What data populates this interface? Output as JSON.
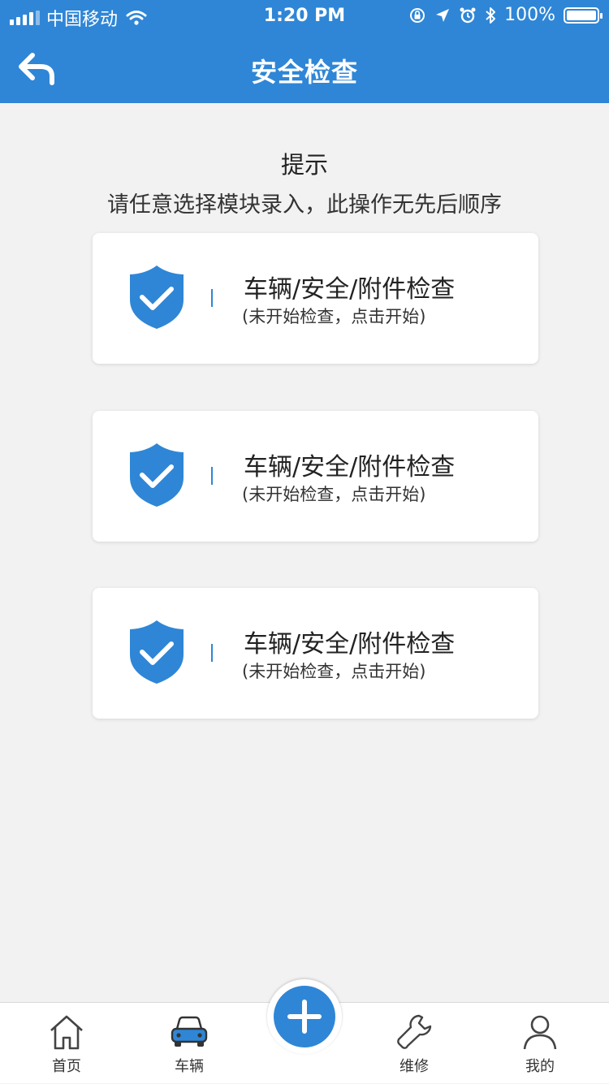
{
  "status_bar": {
    "carrier": "中国移动",
    "time": "1:20 PM",
    "battery": "100%",
    "battery_level": 1.0,
    "icons": [
      "signal-icon",
      "wifi-icon",
      "orientation-lock-icon",
      "location-icon",
      "alarm-icon",
      "bluetooth-icon",
      "battery-icon"
    ]
  },
  "nav": {
    "title": "安全检查",
    "back_icon": "back-arrow-icon"
  },
  "hint": {
    "title": "提示",
    "text": "请任意选择模块录入，此操作无先后顺序"
  },
  "modules": [
    {
      "title": "车辆/安全/附件检查",
      "status": "(未开始检查，点击开始)",
      "icon": "shield-check-icon"
    },
    {
      "title": "车辆/安全/附件检查",
      "status": "(未开始检查，点击开始)",
      "icon": "shield-check-icon"
    },
    {
      "title": "车辆/安全/附件检查",
      "status": "(未开始检查，点击开始)",
      "icon": "shield-check-icon"
    }
  ],
  "tabbar": {
    "tabs": [
      {
        "label": "首页",
        "icon": "home-icon",
        "active": false
      },
      {
        "label": "车辆",
        "icon": "car-icon",
        "active": true
      },
      {
        "label": "维修",
        "icon": "wrench-icon",
        "active": false
      },
      {
        "label": "我的",
        "icon": "user-icon",
        "active": false
      }
    ],
    "center_icon": "plus-icon"
  },
  "colors": {
    "primary": "#2f86d6",
    "background": "#f2f2f2",
    "card": "#ffffff",
    "text": "#222222"
  }
}
